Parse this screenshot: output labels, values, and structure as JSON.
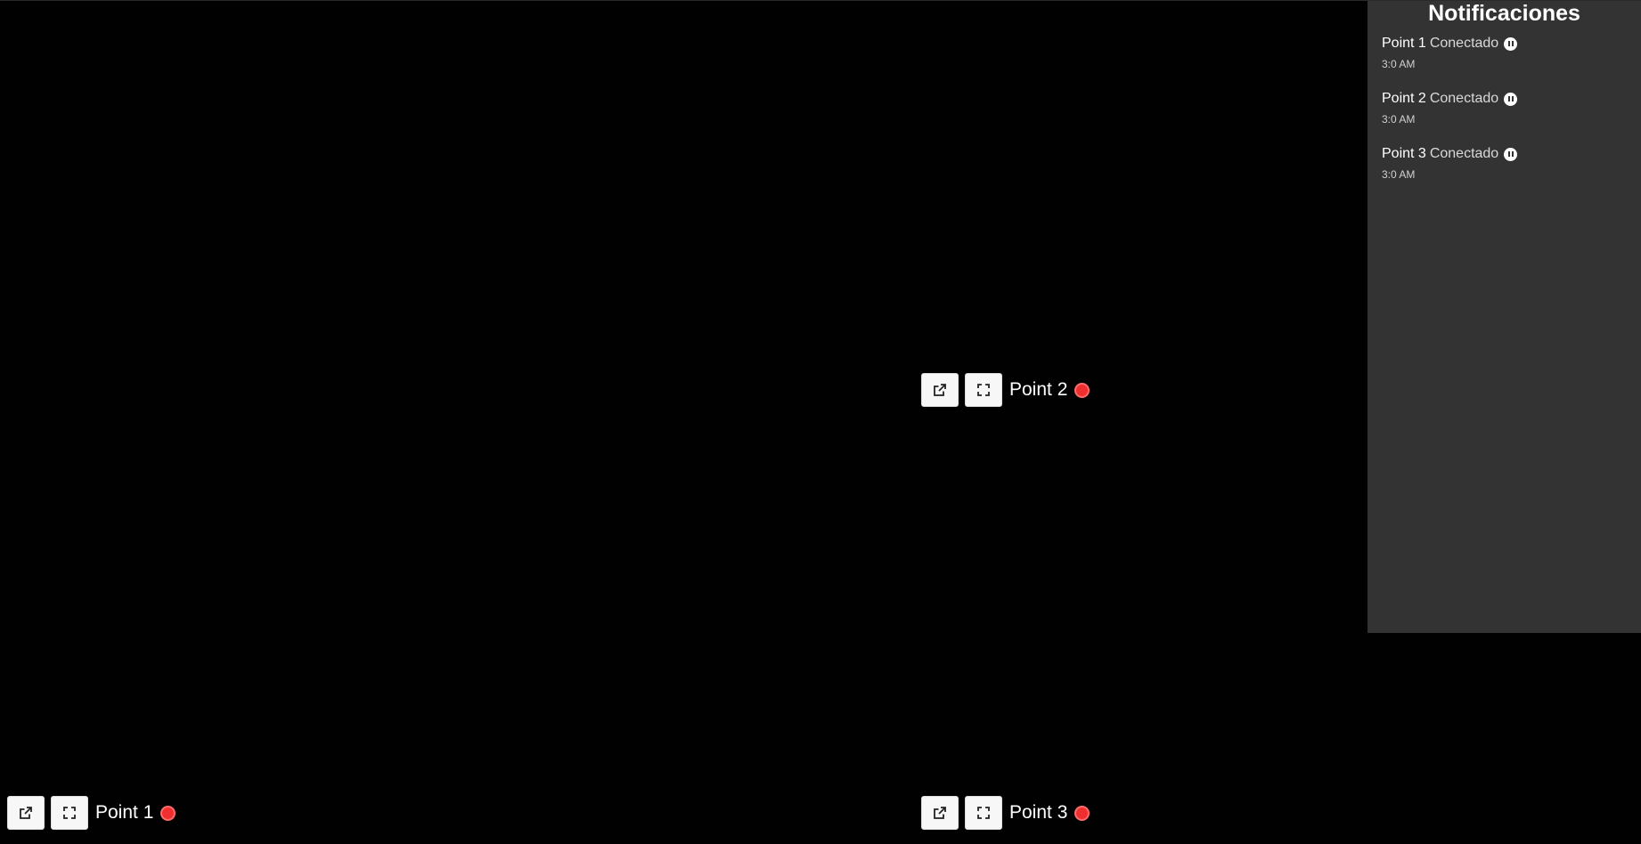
{
  "cameras": [
    {
      "label": "Point 1",
      "open_icon": "external-link-icon",
      "fullscreen_icon": "fullscreen-icon",
      "status_color": "#ef2f2f"
    },
    {
      "label": "Point 2",
      "open_icon": "external-link-icon",
      "fullscreen_icon": "fullscreen-icon",
      "status_color": "#ef2f2f"
    },
    {
      "label": "Point 3",
      "open_icon": "external-link-icon",
      "fullscreen_icon": "fullscreen-icon",
      "status_color": "#ef2f2f"
    }
  ],
  "notifications": {
    "title": "Notificaciones",
    "items": [
      {
        "point": "Point 1",
        "status": "Conectado",
        "icon": "pause-icon",
        "time": "3:0 AM"
      },
      {
        "point": "Point 2",
        "status": "Conectado",
        "icon": "pause-icon",
        "time": "3:0 AM"
      },
      {
        "point": "Point 3",
        "status": "Conectado",
        "icon": "pause-icon",
        "time": "3:0 AM"
      }
    ]
  },
  "colors": {
    "background": "#000000",
    "panel": "#333333",
    "recording": "#ef2f2f",
    "button": "#f7f7f7"
  }
}
